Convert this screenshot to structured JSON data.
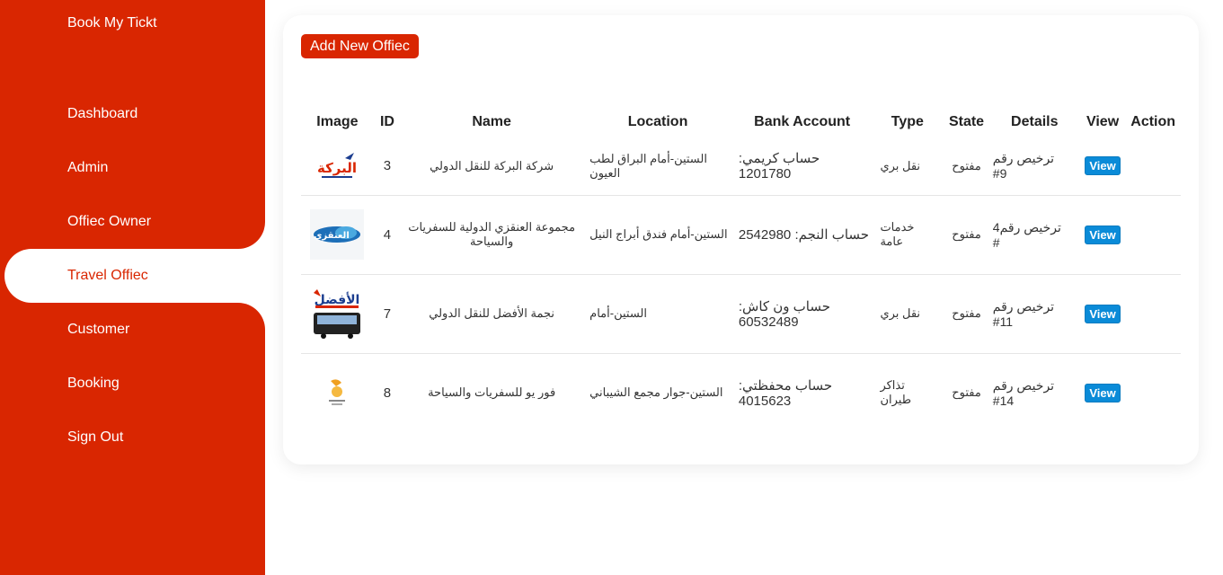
{
  "app": {
    "brand": "Book My Tickt"
  },
  "sidebar": {
    "items": [
      {
        "label": "Dashboard"
      },
      {
        "label": "Admin"
      },
      {
        "label": "Offiec Owner"
      },
      {
        "label": "Travel Offiec"
      },
      {
        "label": "Customer"
      },
      {
        "label": "Booking"
      },
      {
        "label": "Sign Out"
      }
    ],
    "active": "Travel Offiec"
  },
  "main": {
    "add_button_label": "Add New Offiec",
    "table": {
      "headers": [
        "Image",
        "ID",
        "Name",
        "Location",
        "Bank Account",
        "Type",
        "State",
        "Details",
        "View",
        "Action"
      ],
      "rows": [
        {
          "logo": "albaraka-logo",
          "logo_text": "البركة",
          "id": "3",
          "name": "شركة البركة للنقل الدولي",
          "location": "الستين-أمام البراق لطب العيون",
          "bank": "حساب كريمي: 1201780",
          "type": "نقل بري",
          "state": "مفتوح",
          "details": "ترخيص رقم 9#",
          "view": "View"
        },
        {
          "logo": "alanqazi-logo",
          "logo_text": "العنقزي",
          "id": "4",
          "name": "مجموعة العنقزي الدولية للسفريات والسياحة",
          "location": "الستين-أمام فندق أبراج النيل",
          "bank": "حساب النجم: 2542980",
          "type": "خدمات عامة",
          "state": "مفتوح",
          "details": "ترخيص رقم4 #",
          "view": "View"
        },
        {
          "logo": "alafdal-logo",
          "logo_text": "الأفضل",
          "id": "7",
          "name": "نجمة الأفضل للنقل الدولي",
          "location": "الستين-أمام",
          "bank": "حساب ون كاش: 60532489",
          "type": "نقل بري",
          "state": "مفتوح",
          "details": "ترخيص رقم 11#",
          "view": "View"
        },
        {
          "logo": "foryou-logo",
          "logo_text": "",
          "id": "8",
          "name": "فور يو للسفريات والسياحة",
          "location": "الستين-جوار مجمع الشيباني",
          "bank": "حساب محفظتي: 4015623",
          "type": "تذاكر طيران",
          "state": "مفتوح",
          "details": "ترخيص رقم 14#",
          "view": "View"
        }
      ]
    }
  },
  "colors": {
    "primary": "#d92601",
    "view_button": "#0a8bd8"
  }
}
